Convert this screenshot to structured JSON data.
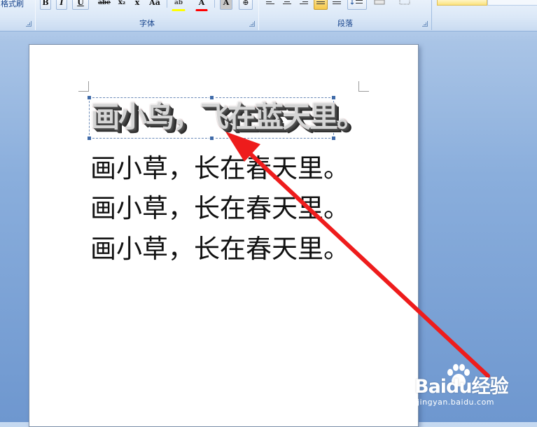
{
  "ribbon": {
    "font_group_label": "字体",
    "paragraph_group_label": "段落",
    "left_group_cut_label": "格式刷",
    "font_buttons": {
      "bold": "B",
      "italic": "I",
      "underline": "U",
      "strikethrough": "abe",
      "subscript": "x₂",
      "clear": "x",
      "change_case": "Aa",
      "highlight": "ab",
      "font_color": "A",
      "char_shading": "A",
      "enclose": "⊕"
    },
    "highlight_color": "#ffff00",
    "font_color": "#ff0000"
  },
  "document": {
    "wordart_text": "画小鸟，飞在蓝天里。",
    "lines": [
      "画小草，长在春天里。",
      "画小草，长在春天里。",
      "画小草，长在春天里。"
    ]
  },
  "annotation": {
    "arrow_color": "#ee1c1c"
  },
  "watermark": {
    "brand": "Baidu经验",
    "url": "jingyan.baidu.com"
  }
}
